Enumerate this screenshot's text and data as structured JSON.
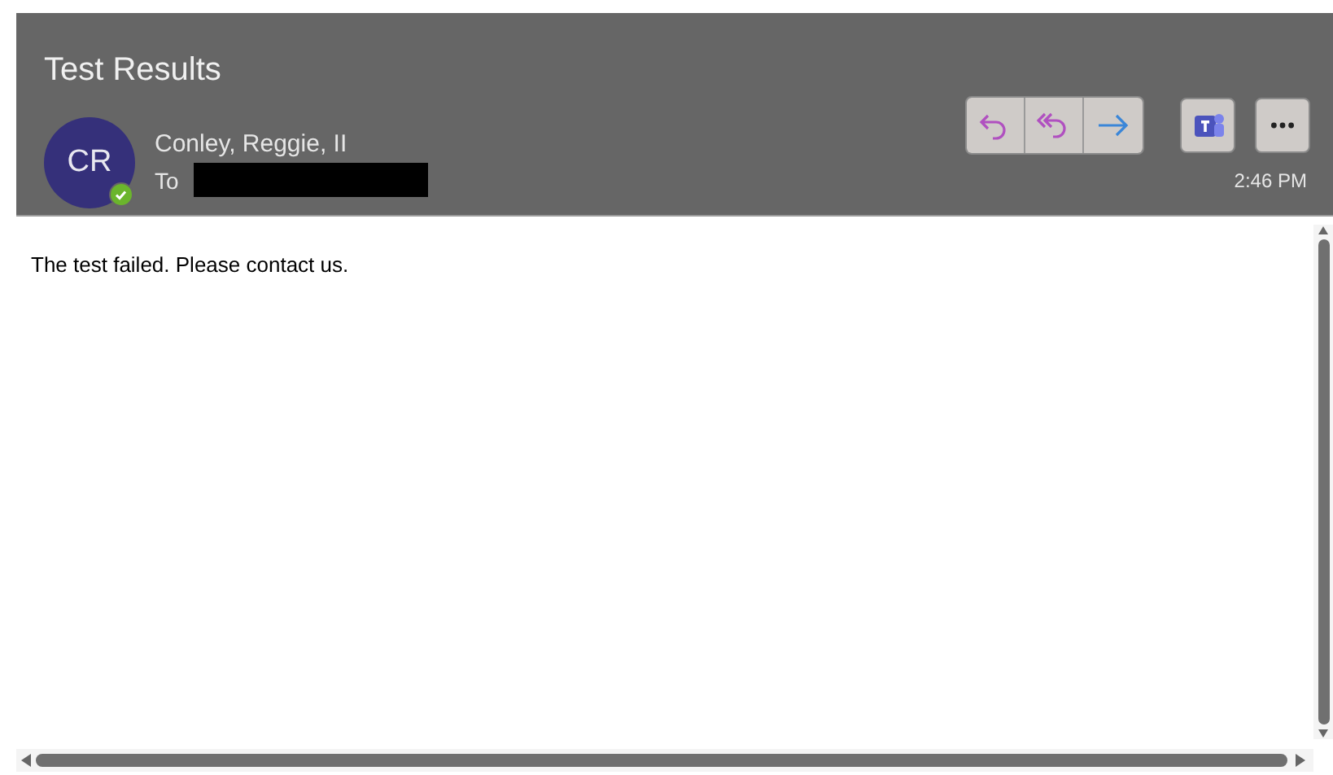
{
  "subject": "Test Results",
  "sender": {
    "initials": "CR",
    "name": "Conley, Reggie, II",
    "online": true
  },
  "to_label": "To",
  "actions": [
    {
      "kind": "reply"
    },
    {
      "kind": "reply_all"
    },
    {
      "kind": "forward"
    },
    {
      "kind": "teams"
    },
    {
      "kind": "more"
    }
  ],
  "time": "2:46 PM",
  "body": "The test failed. Please contact us."
}
